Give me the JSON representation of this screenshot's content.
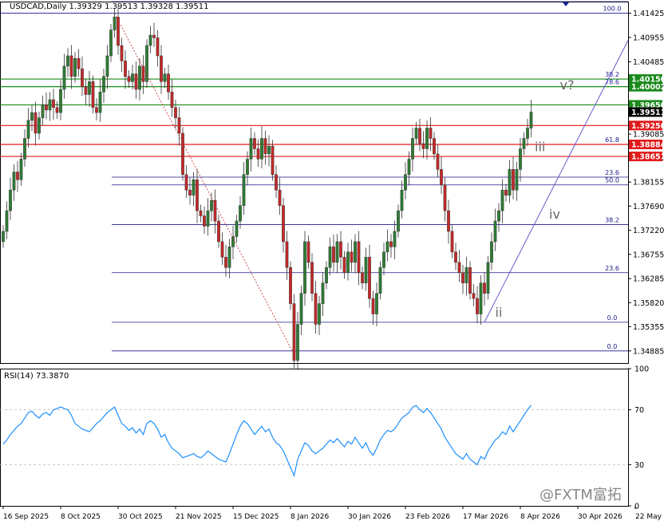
{
  "header": {
    "symbol_info": "USDCAD,Daily  1.39329 1.39513 1.39328 1.39511",
    "rsi_label": "RSI(14) 73.3870"
  },
  "watermark": "@FXTM富拓",
  "chart_data": [
    {
      "type": "candlestick",
      "title": "USDCAD,Daily",
      "ohlc_last": {
        "open": 1.39329,
        "high": 1.39513,
        "low": 1.39328,
        "close": 1.39511
      },
      "ylim": [
        1.3465,
        1.4165
      ],
      "y_ticks": [
        1.41425,
        1.40955,
        1.40485,
        1.4002,
        1.39555,
        1.39085,
        1.3862,
        1.38155,
        1.3769,
        1.3722,
        1.36755,
        1.36285,
        1.3582,
        1.35355,
        1.34885
      ],
      "x_labels": [
        "16 Sep 2025",
        "8 Oct 2025",
        "30 Oct 2025",
        "21 Nov 2025",
        "15 Dec 2025",
        "8 Jan 2026",
        "30 Jan 2026",
        "23 Feb 2026",
        "17 Mar 2026",
        "8 Apr 2026",
        "30 Apr 2026",
        "22 May 2026"
      ],
      "x_label_index": [
        0,
        16,
        32,
        48,
        64,
        80,
        96,
        112,
        128,
        144,
        160,
        176
      ],
      "closes": [
        1.372,
        1.376,
        1.38,
        1.3835,
        1.382,
        1.386,
        1.39,
        1.3935,
        1.395,
        1.391,
        1.394,
        1.3965,
        1.3955,
        1.3975,
        1.396,
        1.395,
        1.3995,
        1.404,
        1.406,
        1.402,
        1.4055,
        1.4035,
        1.4,
        1.3985,
        1.401,
        1.396,
        1.395,
        1.399,
        1.402,
        1.406,
        1.411,
        1.4135,
        1.408,
        1.405,
        1.402,
        1.401,
        1.4025,
        1.3995,
        1.404,
        1.401,
        1.408,
        1.41,
        1.4095,
        1.406,
        1.401,
        1.4025,
        1.399,
        1.396,
        1.394,
        1.391,
        1.383,
        1.38,
        1.379,
        1.382,
        1.376,
        1.375,
        1.373,
        1.376,
        1.378,
        1.374,
        1.37,
        1.367,
        1.365,
        1.369,
        1.371,
        1.374,
        1.377,
        1.383,
        1.386,
        1.39,
        1.388,
        1.386,
        1.39,
        1.387,
        1.3885,
        1.383,
        1.38,
        1.377,
        1.37,
        1.365,
        1.358,
        1.347,
        1.354,
        1.36,
        1.37,
        1.366,
        1.36,
        1.354,
        1.358,
        1.362,
        1.365,
        1.369,
        1.366,
        1.37,
        1.367,
        1.364,
        1.368,
        1.366,
        1.37,
        1.364,
        1.362,
        1.367,
        1.359,
        1.356,
        1.36,
        1.365,
        1.368,
        1.37,
        1.369,
        1.372,
        1.376,
        1.38,
        1.383,
        1.386,
        1.39,
        1.392,
        1.389,
        1.388,
        1.392,
        1.39,
        1.387,
        1.384,
        1.381,
        1.376,
        1.372,
        1.368,
        1.366,
        1.364,
        1.362,
        1.365,
        1.36,
        1.359,
        1.356,
        1.362,
        1.36,
        1.366,
        1.37,
        1.374,
        1.376,
        1.38,
        1.379,
        1.384,
        1.38,
        1.384,
        1.388,
        1.39,
        1.392,
        1.3951
      ],
      "fib_levels": [
        {
          "label": "100.0",
          "price": 1.41425
        },
        {
          "label": "38.2",
          "price": 1.4015
        },
        {
          "label": "78.6",
          "price": 1.40002
        },
        {
          "label": "61.8",
          "price": 1.38884
        },
        {
          "label": "23.6",
          "price": 1.3825
        },
        {
          "label": "50.0",
          "price": 1.381
        },
        {
          "label": "38.2",
          "price": 1.3733
        },
        {
          "label": "23.6",
          "price": 1.364
        },
        {
          "label": "0.0",
          "price": 1.3544
        },
        {
          "label": "0.0",
          "price": 1.34885
        },
        {
          "label": "50.0",
          "price": 1.4165
        }
      ],
      "price_labels": [
        {
          "text": "1.40150",
          "price": 1.4015,
          "color": "#1a8a1a"
        },
        {
          "text": "1.40002",
          "price": 1.40002,
          "color": "#1a8a1a"
        },
        {
          "text": "1.39650",
          "price": 1.3965,
          "color": "#1a8a1a"
        },
        {
          "text": "1.39511",
          "price": 1.39511,
          "color": "#000000"
        },
        {
          "text": "1.39250",
          "price": 1.3925,
          "color": "#e01b1b"
        },
        {
          "text": "1.38884",
          "price": 1.38884,
          "color": "#e01b1b"
        },
        {
          "text": "1.38651",
          "price": 1.38651,
          "color": "#e01b1b"
        }
      ],
      "wave_labels": [
        "ii",
        "iii",
        "iv",
        "v?"
      ],
      "colors": {
        "up": "#2e7d32",
        "down": "#c62828",
        "fib": "#1a1a8a",
        "green_line": "#1a8a1a",
        "red_line": "#e01b1b",
        "trend": "#6a5acd",
        "rsi": "#1e90ff"
      }
    },
    {
      "type": "line",
      "title": "RSI(14) 73.3870",
      "ylim": [
        0,
        100
      ],
      "y_ticks": [
        100,
        70,
        30,
        0
      ],
      "values": [
        45,
        48,
        52,
        55,
        58,
        60,
        64,
        68,
        69,
        66,
        64,
        67,
        68,
        66,
        70,
        71,
        72,
        71,
        70,
        66,
        60,
        58,
        56,
        55,
        54,
        57,
        60,
        62,
        65,
        68,
        70,
        72,
        66,
        60,
        58,
        55,
        57,
        53,
        56,
        52,
        60,
        62,
        60,
        56,
        50,
        52,
        46,
        42,
        40,
        38,
        35,
        36,
        37,
        38,
        36,
        35,
        37,
        40,
        38,
        36,
        34,
        33,
        32,
        38,
        45,
        52,
        58,
        62,
        60,
        56,
        52,
        55,
        58,
        54,
        56,
        50,
        46,
        44,
        40,
        34,
        28,
        22,
        34,
        40,
        46,
        44,
        40,
        38,
        40,
        42,
        45,
        48,
        46,
        49,
        46,
        43,
        47,
        45,
        50,
        46,
        42,
        46,
        40,
        37,
        42,
        48,
        52,
        55,
        54,
        56,
        60,
        64,
        66,
        68,
        72,
        73,
        70,
        68,
        71,
        68,
        64,
        60,
        56,
        50,
        46,
        42,
        38,
        36,
        34,
        38,
        34,
        32,
        30,
        36,
        34,
        40,
        44,
        48,
        50,
        54,
        52,
        58,
        54,
        58,
        62,
        66,
        70,
        73.387
      ]
    }
  ]
}
